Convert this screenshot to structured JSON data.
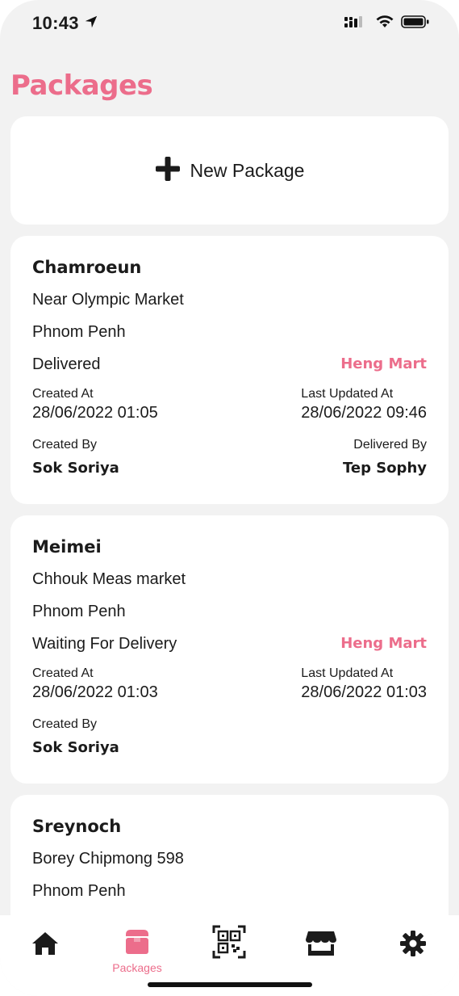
{
  "status_bar": {
    "time": "10:43"
  },
  "header": {
    "title": "Packages"
  },
  "new_package": {
    "label": "New Package"
  },
  "packages": [
    {
      "name": "Chamroeun",
      "address": "Near Olympic Market",
      "city": "Phnom Penh",
      "status": "Delivered",
      "shop": "Heng Mart",
      "created_at_label": "Created At",
      "created_at": "28/06/2022 01:05",
      "updated_at_label": "Last Updated At",
      "updated_at": "28/06/2022 09:46",
      "created_by_label": "Created By",
      "created_by": "Sok Soriya",
      "delivered_by_label": "Delivered By",
      "delivered_by": "Tep Sophy"
    },
    {
      "name": "Meimei",
      "address": "Chhouk Meas market",
      "city": "Phnom Penh",
      "status": "Waiting For Delivery",
      "shop": "Heng Mart",
      "created_at_label": "Created At",
      "created_at": "28/06/2022 01:03",
      "updated_at_label": "Last Updated At",
      "updated_at": "28/06/2022 01:03",
      "created_by_label": "Created By",
      "created_by": "Sok Soriya"
    },
    {
      "name": "Sreynoch",
      "address": "Borey Chipmong 598",
      "city": "Phnom Penh"
    }
  ],
  "tab_bar": {
    "active_tab": "packages",
    "packages_label": "Packages",
    "icons": [
      "home-icon",
      "package-icon",
      "qr-code-icon",
      "store-icon",
      "gear-icon"
    ]
  },
  "colors": {
    "accent": "#ec6d8b",
    "background": "#f2f2f2",
    "card": "#ffffff",
    "text": "#1b1b1b"
  }
}
